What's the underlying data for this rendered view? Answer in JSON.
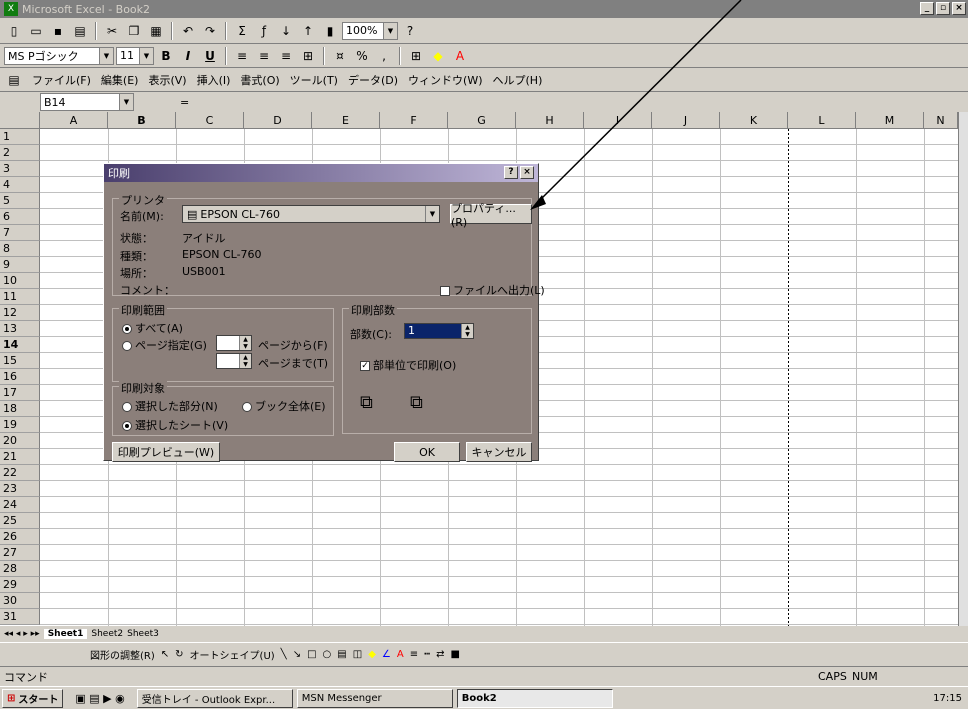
{
  "app": {
    "title": "Microsoft Excel - Book2",
    "xl_icon": "X"
  },
  "window_buttons": [
    "_",
    "×"
  ],
  "toolbar": {
    "zoom": "100%",
    "font_name": "MS Pゴシック",
    "font_size": "11",
    "bold": "B",
    "italic": "I",
    "underline": "U"
  },
  "menu": [
    "ファイル(F)",
    "編集(E)",
    "表示(V)",
    "挿入(I)",
    "書式(O)",
    "ツール(T)",
    "データ(D)",
    "ウィンドウ(W)",
    "ヘルプ(H)"
  ],
  "formula": {
    "cell_ref": "B14",
    "equals": "="
  },
  "columns": [
    "A",
    "B",
    "C",
    "D",
    "E",
    "F",
    "G",
    "H",
    "I",
    "J",
    "K",
    "L",
    "M",
    "N"
  ],
  "rows": [
    "1",
    "2",
    "3",
    "4",
    "5",
    "6",
    "7",
    "8",
    "9",
    "10",
    "11",
    "12",
    "13",
    "14",
    "15",
    "16",
    "17",
    "18",
    "19",
    "20",
    "21",
    "22",
    "23",
    "24",
    "25",
    "26",
    "27",
    "28",
    "29",
    "30",
    "31"
  ],
  "sheets": [
    "Sheet1",
    "Sheet2",
    "Sheet3"
  ],
  "drawing": {
    "adjust": "図形の調整(R)",
    "autoshape": "オートシェイプ(U)"
  },
  "status": {
    "mode": "コマンド",
    "caps": "CAPS",
    "num": "NUM"
  },
  "taskbar": {
    "start": "スタート",
    "items": [
      "受信トレイ - Outlook Expr...",
      "MSN Messenger",
      "Book2"
    ],
    "clock": "17:15"
  },
  "dialog": {
    "title": "印刷",
    "help": "?",
    "close": "×",
    "printer_group": "プリンタ",
    "name_label": "名前(M):",
    "printer_name": "EPSON CL-760",
    "properties": "プロパティ...(R)",
    "status_label": "状態：",
    "status_value": "アイドル",
    "type_label": "種類：",
    "type_value": "EPSON CL-760",
    "where_label": "場所：",
    "where_value": "USB001",
    "comment_label": "コメント：",
    "print_to_file": "ファイルへ出力(L)",
    "range_group": "印刷範囲",
    "all": "すべて(A)",
    "pages": "ページ指定(G)",
    "from": "ページから(F)",
    "to": "ページまで(T)",
    "copies_group": "印刷部数",
    "copies_label": "部数(C):",
    "copies_value": "1",
    "collate": "部単位で印刷(O)",
    "what_group": "印刷対象",
    "selection": "選択した部分(N)",
    "workbook": "ブック全体(E)",
    "sheets": "選択したシート(V)",
    "preview": "印刷プレビュー(W)",
    "ok": "OK",
    "cancel": "キャンセル"
  }
}
